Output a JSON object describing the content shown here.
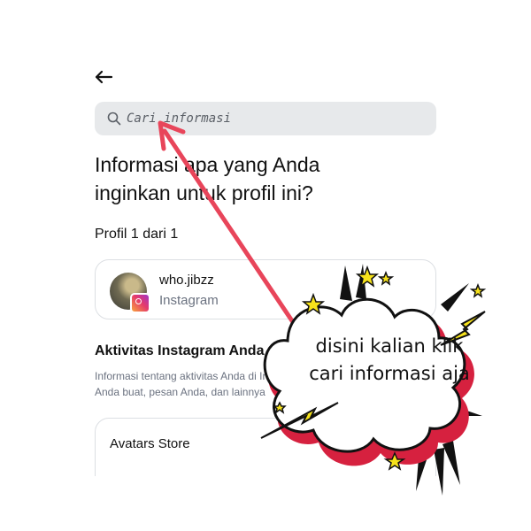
{
  "header": {
    "back_icon": "arrow-left-icon"
  },
  "search": {
    "placeholder": "Cari informasi",
    "icon": "search-icon"
  },
  "main": {
    "heading": "Informasi apa yang Anda inginkan untuk profil ini?",
    "profile_count": "Profil 1 dari 1",
    "profile": {
      "name": "who.jibzz",
      "platform": "Instagram",
      "badge_icon": "instagram-icon"
    },
    "section_title": "Aktivitas Instagram Anda",
    "section_desc_line1": "Informasi tentang aktivitas Anda di Instagram, seperti postingan yang",
    "section_desc_line2": "Anda buat, pesan Anda, dan lainnya",
    "store_label": "Avatars Store"
  },
  "annotation": {
    "callout_line1": "disini kalian klik",
    "callout_line2": "cari informasi aja",
    "arrow_color": "#e8455a",
    "accent_red": "#d6213f",
    "star_yellow": "#f6e21b"
  }
}
